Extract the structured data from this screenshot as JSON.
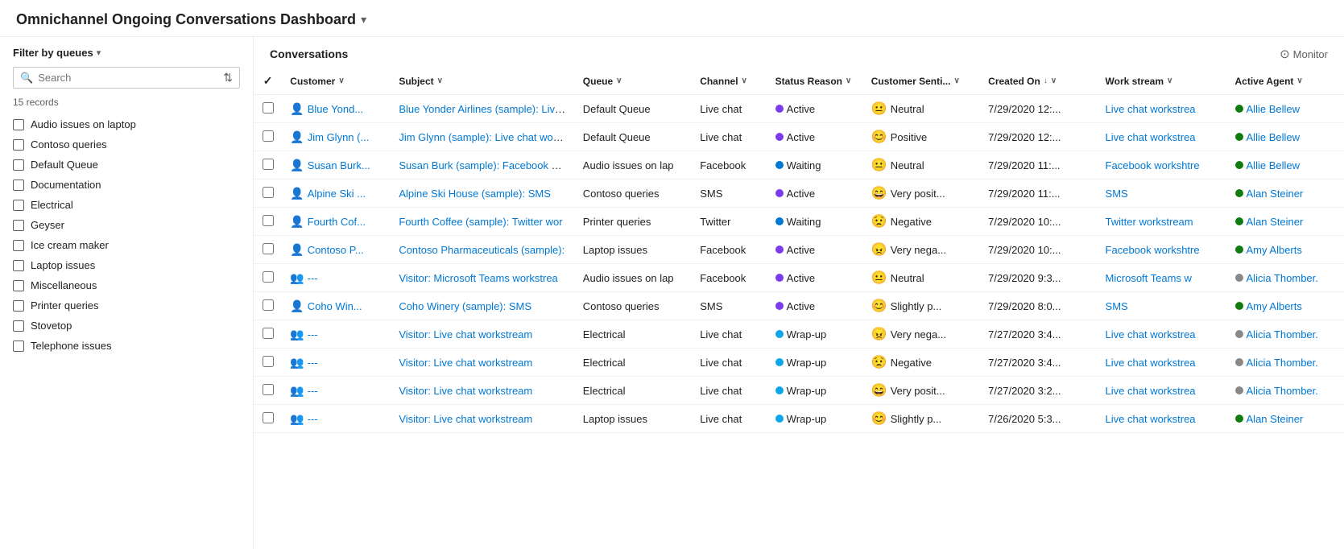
{
  "header": {
    "title": "Omnichannel Ongoing Conversations Dashboard",
    "chevron": "▾"
  },
  "sidebar": {
    "filter_label": "Filter by queues",
    "filter_chevron": "▾",
    "search_placeholder": "Search",
    "records_count": "15 records",
    "sort_icon": "⇅",
    "queues": [
      {
        "label": "Audio issues on laptop",
        "checked": false
      },
      {
        "label": "Contoso queries",
        "checked": false
      },
      {
        "label": "Default Queue",
        "checked": false
      },
      {
        "label": "Documentation",
        "checked": false
      },
      {
        "label": "Electrical",
        "checked": false
      },
      {
        "label": "Geyser",
        "checked": false
      },
      {
        "label": "Ice cream maker",
        "checked": false
      },
      {
        "label": "Laptop issues",
        "checked": false
      },
      {
        "label": "Miscellaneous",
        "checked": false
      },
      {
        "label": "Printer queries",
        "checked": false
      },
      {
        "label": "Stovetop",
        "checked": false
      },
      {
        "label": "Telephone issues",
        "checked": false
      }
    ]
  },
  "conversations": {
    "title": "Conversations",
    "monitor_label": "Monitor",
    "monitor_icon": "⊙",
    "columns": [
      {
        "key": "customer",
        "label": "Customer",
        "sortable": true,
        "has_chevron": true
      },
      {
        "key": "subject",
        "label": "Subject",
        "sortable": true,
        "has_chevron": true
      },
      {
        "key": "queue",
        "label": "Queue",
        "sortable": true,
        "has_chevron": true
      },
      {
        "key": "channel",
        "label": "Channel",
        "sortable": true,
        "has_chevron": true
      },
      {
        "key": "status_reason",
        "label": "Status Reason",
        "sortable": true,
        "has_chevron": true
      },
      {
        "key": "customer_sentiment",
        "label": "Customer Senti...",
        "sortable": true,
        "has_chevron": true
      },
      {
        "key": "created_on",
        "label": "Created On",
        "sortable": true,
        "sort_dir": "desc",
        "has_chevron": true
      },
      {
        "key": "work_stream",
        "label": "Work stream",
        "sortable": true,
        "has_chevron": true
      },
      {
        "key": "active_agent",
        "label": "Active Agent",
        "sortable": true,
        "has_chevron": true
      }
    ],
    "rows": [
      {
        "customer": "Blue Yond...",
        "customer_type": "person",
        "subject": "Blue Yonder Airlines (sample): Live c",
        "queue": "Default Queue",
        "channel": "Live chat",
        "status_dot": "purple",
        "status_reason": "Active",
        "sentiment_face": "😐",
        "sentiment_label": "Neutral",
        "created_on": "7/29/2020 12:...",
        "work_stream": "Live chat workstrea",
        "agent_dot": "green",
        "active_agent": "Allie Bellew"
      },
      {
        "customer": "Jim Glynn (...",
        "customer_type": "person",
        "subject": "Jim Glynn (sample): Live chat works",
        "queue": "Default Queue",
        "channel": "Live chat",
        "status_dot": "purple",
        "status_reason": "Active",
        "sentiment_face": "😊",
        "sentiment_label": "Positive",
        "created_on": "7/29/2020 12:...",
        "work_stream": "Live chat workstrea",
        "agent_dot": "green",
        "active_agent": "Allie Bellew"
      },
      {
        "customer": "Susan Burk...",
        "customer_type": "person",
        "subject": "Susan Burk (sample): Facebook wor",
        "queue": "Audio issues on lap",
        "channel": "Facebook",
        "status_dot": "blue",
        "status_reason": "Waiting",
        "sentiment_face": "😐",
        "sentiment_label": "Neutral",
        "created_on": "7/29/2020 11:...",
        "work_stream": "Facebook workshtre",
        "agent_dot": "green",
        "active_agent": "Allie Bellew"
      },
      {
        "customer": "Alpine Ski ...",
        "customer_type": "person",
        "subject": "Alpine Ski House (sample): SMS",
        "queue": "Contoso queries",
        "channel": "SMS",
        "status_dot": "purple",
        "status_reason": "Active",
        "sentiment_face": "😄",
        "sentiment_label": "Very posit...",
        "created_on": "7/29/2020 11:...",
        "work_stream": "SMS",
        "agent_dot": "green",
        "active_agent": "Alan Steiner"
      },
      {
        "customer": "Fourth Cof...",
        "customer_type": "person",
        "subject": "Fourth Coffee (sample): Twitter wor",
        "queue": "Printer queries",
        "channel": "Twitter",
        "status_dot": "blue",
        "status_reason": "Waiting",
        "sentiment_face": "😟",
        "sentiment_label": "Negative",
        "created_on": "7/29/2020 10:...",
        "work_stream": "Twitter workstream",
        "agent_dot": "green",
        "active_agent": "Alan Steiner"
      },
      {
        "customer": "Contoso P...",
        "customer_type": "person",
        "subject": "Contoso Pharmaceuticals (sample):",
        "queue": "Laptop issues",
        "channel": "Facebook",
        "status_dot": "purple",
        "status_reason": "Active",
        "sentiment_face": "😠",
        "sentiment_label": "Very nega...",
        "created_on": "7/29/2020 10:...",
        "work_stream": "Facebook workshtre",
        "agent_dot": "green",
        "active_agent": "Amy Alberts"
      },
      {
        "customer": "---",
        "customer_type": "visitor",
        "subject": "Visitor: Microsoft Teams workstrea",
        "queue": "Audio issues on lap",
        "channel": "Facebook",
        "status_dot": "purple",
        "status_reason": "Active",
        "sentiment_face": "😐",
        "sentiment_label": "Neutral",
        "created_on": "7/29/2020 9:3...",
        "work_stream": "Microsoft Teams w",
        "agent_dot": "gray",
        "active_agent": "Alicia Thomber."
      },
      {
        "customer": "Coho Win...",
        "customer_type": "person",
        "subject": "Coho Winery (sample): SMS",
        "queue": "Contoso queries",
        "channel": "SMS",
        "status_dot": "purple",
        "status_reason": "Active",
        "sentiment_face": "😊",
        "sentiment_label": "Slightly p...",
        "created_on": "7/29/2020 8:0...",
        "work_stream": "SMS",
        "agent_dot": "green",
        "active_agent": "Amy Alberts"
      },
      {
        "customer": "---",
        "customer_type": "visitor",
        "subject": "Visitor: Live chat workstream",
        "queue": "Electrical",
        "channel": "Live chat",
        "status_dot": "teal",
        "status_reason": "Wrap-up",
        "sentiment_face": "😠",
        "sentiment_label": "Very nega...",
        "created_on": "7/27/2020 3:4...",
        "work_stream": "Live chat workstrea",
        "agent_dot": "gray",
        "active_agent": "Alicia Thomber."
      },
      {
        "customer": "---",
        "customer_type": "visitor",
        "subject": "Visitor: Live chat workstream",
        "queue": "Electrical",
        "channel": "Live chat",
        "status_dot": "teal",
        "status_reason": "Wrap-up",
        "sentiment_face": "😟",
        "sentiment_label": "Negative",
        "created_on": "7/27/2020 3:4...",
        "work_stream": "Live chat workstrea",
        "agent_dot": "gray",
        "active_agent": "Alicia Thomber."
      },
      {
        "customer": "---",
        "customer_type": "visitor",
        "subject": "Visitor: Live chat workstream",
        "queue": "Electrical",
        "channel": "Live chat",
        "status_dot": "teal",
        "status_reason": "Wrap-up",
        "sentiment_face": "😄",
        "sentiment_label": "Very posit...",
        "created_on": "7/27/2020 3:2...",
        "work_stream": "Live chat workstrea",
        "agent_dot": "gray",
        "active_agent": "Alicia Thomber."
      },
      {
        "customer": "---",
        "customer_type": "visitor",
        "subject": "Visitor: Live chat workstream",
        "queue": "Laptop issues",
        "channel": "Live chat",
        "status_dot": "teal",
        "status_reason": "Wrap-up",
        "sentiment_face": "😊",
        "sentiment_label": "Slightly p...",
        "created_on": "7/26/2020 5:3...",
        "work_stream": "Live chat workstrea",
        "agent_dot": "green",
        "active_agent": "Alan Steiner"
      }
    ]
  }
}
